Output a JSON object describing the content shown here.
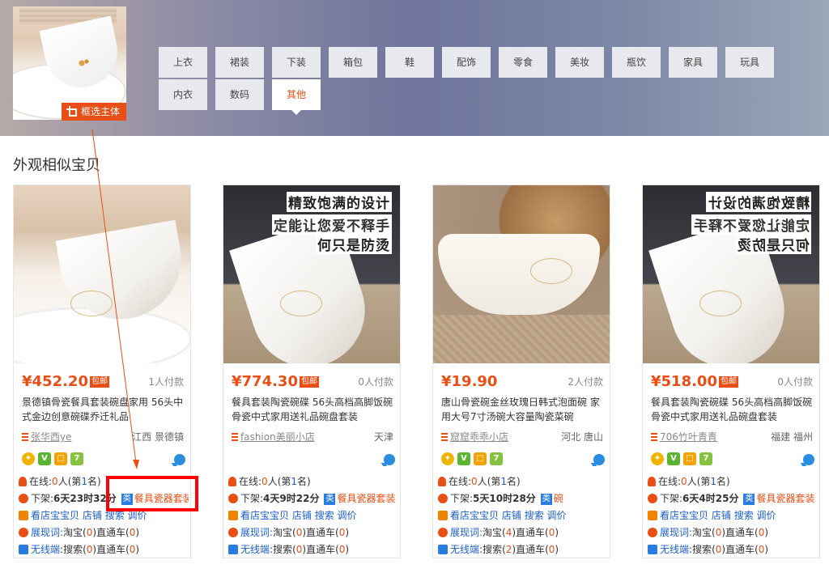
{
  "crop_button": {
    "label": "框选主体",
    "icon": "crop-icon"
  },
  "categories": {
    "row1": [
      "上衣",
      "裙装",
      "下装",
      "箱包",
      "鞋",
      "配饰",
      "零食",
      "美妆",
      "瓶饮",
      "家具",
      "玩具"
    ],
    "row2": [
      "内衣",
      "数码",
      "其他"
    ],
    "active": "其他"
  },
  "section_title": "外观相似宝贝",
  "products": [
    {
      "price": "¥452.20",
      "badge": "包邮",
      "paid": "1人付款",
      "title": "景德镇骨瓷餐具套装碗盘家用 56头中式金边创意碗碟乔迁礼品",
      "shop": "张华西ye",
      "location": "江西 景德镇",
      "online_prefix": "在线:",
      "online_count": "0",
      "online_suffix": "人(第",
      "rank": "1",
      "rank_suffix": "名)",
      "offline_prefix": "下架:",
      "offline_time": "6天23时32分",
      "category_tag": "类",
      "category": "餐具瓷器套装",
      "links": {
        "l1": "看店宝宝贝",
        "l2": "店铺",
        "l3": "搜索",
        "l4": "调价"
      },
      "exposure_label": "展现词:",
      "taobao_label": "淘宝(",
      "taobao": "0",
      "ztc_label": ")直通车(",
      "ztc": "0",
      "close": ")",
      "wireless_label": "无线端",
      "search_label": "搜索(",
      "search": "0",
      "ztc2": "0",
      "image_text": []
    },
    {
      "price": "¥774.30",
      "badge": "包邮",
      "paid": "0人付款",
      "title": "餐具套装陶瓷碗碟 56头高档高脚饭碗骨瓷中式家用送礼品碗盘套装",
      "shop": "fashion美丽小店",
      "location": "天津",
      "online_prefix": "在线:",
      "online_count": "0",
      "online_suffix": "人(第",
      "rank": "1",
      "rank_suffix": "名)",
      "offline_prefix": "下架:",
      "offline_time": "4天9时22分",
      "category_tag": "类",
      "category": "餐具瓷器套装",
      "links": {
        "l1": "看店宝宝贝",
        "l2": "店铺",
        "l3": "搜索",
        "l4": "调价"
      },
      "exposure_label": "展现词:",
      "taobao_label": "淘宝(",
      "taobao": "0",
      "ztc_label": ")直通车(",
      "ztc": "0",
      "close": ")",
      "wireless_label": "无线端",
      "search_label": "搜索(",
      "search": "0",
      "ztc2": "0",
      "image_text": [
        "精致饱满的设计",
        "定能让您爱不释手",
        "何只是防烫"
      ]
    },
    {
      "price": "¥19.90",
      "badge": "",
      "paid": "2人付款",
      "title": "唐山骨瓷碗金丝玫瑰日韩式泡面碗 家用大号7寸汤碗大容量陶瓷菜碗",
      "shop": "窟窟乖乖小店",
      "location": "河北 唐山",
      "online_prefix": "在线:",
      "online_count": "0",
      "online_suffix": "人(第",
      "rank": "1",
      "rank_suffix": "名)",
      "offline_prefix": "下架:",
      "offline_time": "5天10时28分",
      "category_tag": "类",
      "category": "碗",
      "links": {
        "l1": "看店宝宝贝",
        "l2": "店铺",
        "l3": "搜索",
        "l4": "调价"
      },
      "exposure_label": "展现词:",
      "taobao_label": "淘宝(",
      "taobao": "4",
      "ztc_label": ")直通车(",
      "ztc": "0",
      "close": ")",
      "wireless_label": "无线端",
      "search_label": "搜索(",
      "search": "2",
      "ztc2": "0",
      "image_text": []
    },
    {
      "price": "¥518.00",
      "badge": "包邮",
      "paid": "0人付款",
      "title": "餐具套装陶瓷碗碟 56头高档高脚饭碗骨瓷中式家用送礼品碗盘套装",
      "shop": "706竹叶青青",
      "location": "福建 福州",
      "online_prefix": "在线:",
      "online_count": "0",
      "online_suffix": "人(第",
      "rank": "1",
      "rank_suffix": "名)",
      "offline_prefix": "下架:",
      "offline_time": "6天4时25分",
      "category_tag": "类",
      "category": "餐具瓷器套装",
      "links": {
        "l1": "看店宝宝贝",
        "l2": "店铺",
        "l3": "搜索",
        "l4": "调价"
      },
      "exposure_label": "展现词:",
      "taobao_label": "淘宝(",
      "taobao": "0",
      "ztc_label": ")直通车(",
      "ztc": "0",
      "close": ")",
      "wireless_label": "无线端",
      "search_label": "搜索(",
      "search": "0",
      "ztc2": "0",
      "image_text": [
        "精致饱满的设计",
        "定能让您爱不释手",
        "何只是防烫"
      ]
    }
  ],
  "annotation": {
    "highlight_color": "#ff0000"
  }
}
